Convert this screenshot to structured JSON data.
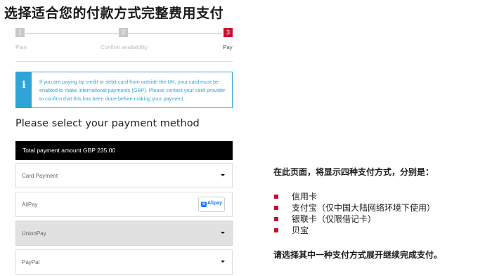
{
  "page_title": "选择适合您的付款方式完整费用支付",
  "stepper": {
    "steps": [
      {
        "number": "1",
        "label": "Plan"
      },
      {
        "number": "2",
        "label": "Confirm availability"
      },
      {
        "number": "3",
        "label": "Pay"
      }
    ],
    "active_color": "#c8102e"
  },
  "info": {
    "icon": "info-icon",
    "text": "If you are paying by credit or debit card from outside the UK, your card must be enabled to make international payments (GBP). Please contact your card provider to confirm that this has been done before making your payment."
  },
  "payment": {
    "heading": "Please select your payment method",
    "total_text": "Total payment amount GBP 235.00",
    "methods": [
      {
        "label": "Card Payment",
        "control": "chevron-down-icon"
      },
      {
        "label": "AliPay",
        "control": "alipay-logo",
        "badge_text": "Alipay",
        "badge_glyph": "支"
      },
      {
        "label": "UnionPay",
        "control": "chevron-down-icon",
        "highlighted": true
      },
      {
        "label": "PayPal",
        "control": "chevron-down-icon"
      }
    ]
  },
  "notes": {
    "intro": "在此页面，将显示四种支付方式，分别是：",
    "items": [
      "信用卡",
      "支付宝（仅中国大陆网络环境下使用）",
      "银联卡（仅限借记卡）",
      "贝宝"
    ],
    "outro": "请选择其中一种支付方式展开继续完成支付。",
    "bullet_color": "#c8102e"
  }
}
